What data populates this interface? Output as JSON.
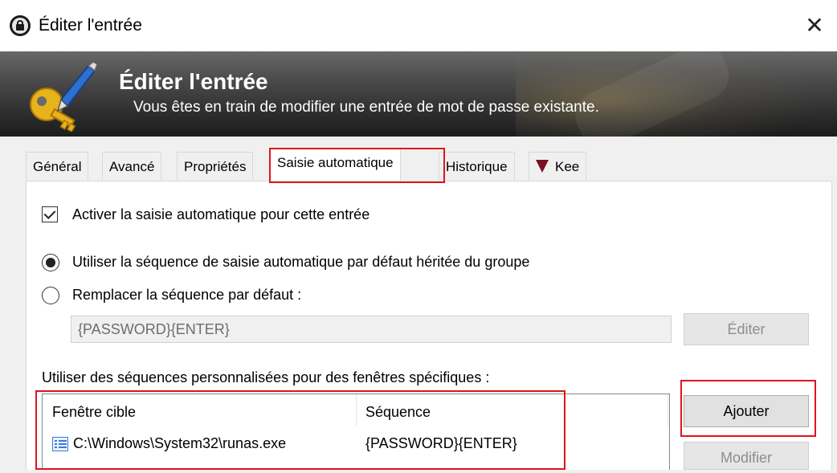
{
  "window": {
    "title": "Éditer l'entrée",
    "close_glyph": "✕"
  },
  "banner": {
    "title": "Éditer l'entrée",
    "subtitle": "Vous êtes en train de modifier une entrée de mot de passe existante."
  },
  "tabs": [
    {
      "label": "Général"
    },
    {
      "label": "Avancé"
    },
    {
      "label": "Propriétés"
    },
    {
      "label": "Saisie automatique",
      "active": true
    },
    {
      "label": "Historique"
    },
    {
      "label": "Kee",
      "icon": "kee-icon"
    }
  ],
  "autotype": {
    "enable_label": "Activer la saisie automatique pour cette entrée",
    "enable_checked": true,
    "inherit_label": "Utiliser la séquence de saisie automatique par défaut héritée du groupe",
    "inherit_selected": true,
    "override_label": "Remplacer la séquence par défaut :",
    "override_selected": false,
    "override_value": "{PASSWORD}{ENTER}",
    "edit_button": "Éditer",
    "custom_label": "Utiliser des séquences personnalisées pour des fenêtres spécifiques :",
    "columns": [
      "Fenêtre cible",
      "Séquence"
    ],
    "rows": [
      {
        "window": "C:\\Windows\\System32\\runas.exe",
        "sequence": "{PASSWORD}{ENTER}",
        "icon": "window-list-icon"
      }
    ],
    "add_button": "Ajouter",
    "modify_button": "Modifier"
  },
  "colors": {
    "highlight": "#e0141b",
    "banner_text": "#ffffff",
    "disabled_text": "#6d6d6d"
  }
}
